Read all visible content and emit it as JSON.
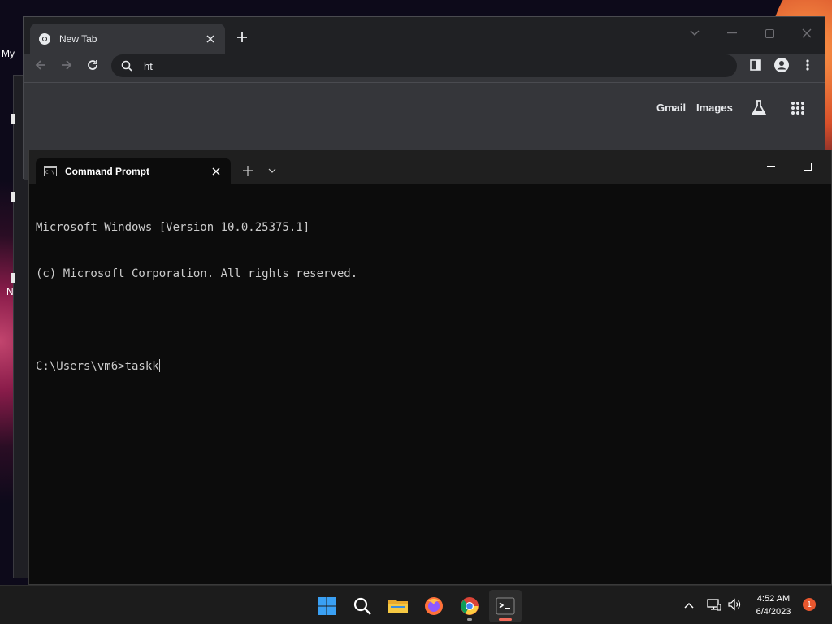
{
  "desktop": {
    "label_partial": "My",
    "side_letter": "N"
  },
  "chrome": {
    "tab_title": "New Tab",
    "omnibox_value": "ht",
    "links": {
      "gmail": "Gmail",
      "images": "Images"
    },
    "icons": [
      "chrome-favicon",
      "close-icon",
      "plus-icon",
      "back-arrow-icon",
      "forward-arrow-icon",
      "reload-icon",
      "search-icon",
      "side-panel-icon",
      "profile-icon",
      "more-vert-icon",
      "labs-flask-icon",
      "apps-grid-icon"
    ]
  },
  "terminal": {
    "tab_title": "Command Prompt",
    "lines": [
      "Microsoft Windows [Version 10.0.25375.1]",
      "(c) Microsoft Corporation. All rights reserved.",
      "",
      "C:\\Users\\vm6>taskk"
    ]
  },
  "taskbar": {
    "apps": [
      "start-icon",
      "search-icon",
      "file-explorer-icon",
      "firefox-icon",
      "chrome-icon",
      "terminal-icon"
    ],
    "clock_time": "4:52 AM",
    "clock_date": "6/4/2023",
    "notification_count": "1"
  },
  "colors": {
    "chrome_frame": "#202124",
    "chrome_toolbar": "#35363a",
    "terminal_bg": "#0c0c0c",
    "terminal_text": "#cccccc",
    "taskbar": "#1c1c1c",
    "badge": "#e8572e"
  }
}
